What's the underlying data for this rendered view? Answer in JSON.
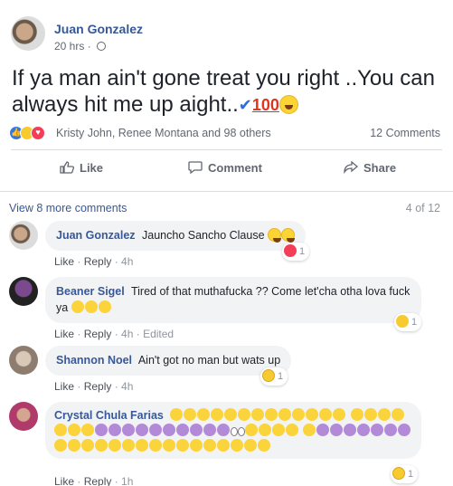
{
  "post": {
    "author": "Juan Gonzalez",
    "time": "20 hrs",
    "time_sep": "·",
    "text": "If ya man ain't gone treat you right ..You can always hit me up aight..",
    "text_emoji": [
      "check-mark",
      "hundred-points",
      "laughing-tears"
    ],
    "reactions": [
      "like",
      "haha",
      "love"
    ],
    "reaction_names": "Kristy John, Renee Montana and 98 others",
    "comment_count": "12 Comments"
  },
  "actions": {
    "like": "Like",
    "comment": "Comment",
    "share": "Share"
  },
  "comments_section": {
    "view_more": "View 8 more comments",
    "page_count": "4 of 12",
    "comments": [
      {
        "name": "Juan Gonzalez",
        "text": "Jauncho Sancho Clause",
        "emoji": "laughing-tears x2",
        "like": "Like",
        "reply": "Reply",
        "time": "4h",
        "edited": "",
        "reaction": "love",
        "reaction_count": "1"
      },
      {
        "name": "Beaner Sigel",
        "text": "Tired of that muthafucka ?? Come let'cha otha lova fuck ya",
        "emoji": "rolling-laughing x3",
        "like": "Like",
        "reply": "Reply",
        "time": "4h",
        "edited": "Edited",
        "reaction": "haha",
        "reaction_count": "1"
      },
      {
        "name": "Shannon Noel",
        "text": "Ain't got no man but wats up",
        "like": "Like",
        "reply": "Reply",
        "time": "4h",
        "reaction": "wow",
        "reaction_count": "1"
      },
      {
        "name": "Crystal Chula Farias",
        "text": "",
        "emoji": "long emoji string",
        "like": "Like",
        "reply": "Reply",
        "time": "1h",
        "reaction": "wow",
        "reaction_count": "1"
      }
    ]
  },
  "colors": {
    "link_blue": "#385898",
    "author_blue": "#365899",
    "muted": "#616770",
    "bubble_bg": "#f2f3f5"
  }
}
